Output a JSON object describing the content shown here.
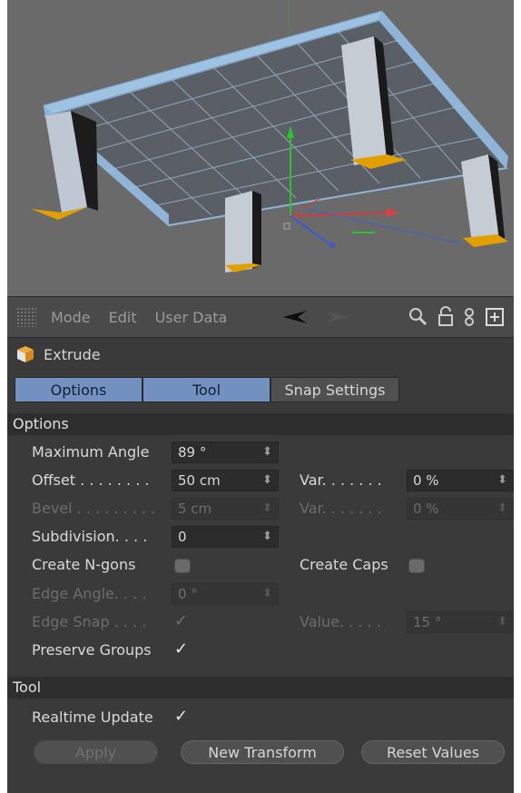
{
  "toolbar": {
    "menu": [
      "Mode",
      "Edit",
      "User Data"
    ],
    "icons": [
      "grip-icon",
      "back-arrow-icon",
      "forward-arrow-icon",
      "search-icon",
      "lock-icon",
      "link-icon",
      "new-panel-icon"
    ]
  },
  "object": {
    "name": "Extrude",
    "icon": "extrude-icon"
  },
  "tabs": [
    "Options",
    "Tool",
    "Snap Settings"
  ],
  "active_tabs": [
    "Options",
    "Tool"
  ],
  "sections": {
    "options": "Options",
    "tool": "Tool"
  },
  "fields": {
    "maximum_angle": {
      "label": "Maximum Angle",
      "value": "89 °"
    },
    "offset": {
      "label": "Offset . . . . . . . .",
      "value": "50 cm",
      "var_label": "Var. . . . . . .",
      "var_value": "0 %"
    },
    "bevel": {
      "label": "Bevel . . . . . . . . .",
      "value": "5 cm",
      "var_label": "Var. . . . . . .",
      "var_value": "0 %"
    },
    "subdivision": {
      "label": "Subdivision. . . .",
      "value": "0"
    },
    "create_ngons": {
      "label": "Create N-gons",
      "checked": false
    },
    "create_caps": {
      "label": "Create Caps",
      "checked": false
    },
    "edge_angle": {
      "label": "Edge Angle. . . .",
      "value": "0 °"
    },
    "edge_snap": {
      "label": "Edge Snap . . . .",
      "checked": true,
      "value_label": "Value. . . . .",
      "value": "15 °"
    },
    "preserve_groups": {
      "label": "Preserve Groups",
      "checked": true
    },
    "realtime_update": {
      "label": "Realtime Update",
      "checked": true
    }
  },
  "buttons": {
    "apply": "Apply",
    "new_transform": "New Transform",
    "reset_values": "Reset Values"
  },
  "glyphs": {
    "check": "✓",
    "spin": "⬍"
  },
  "colors": {
    "viewport_bg": "#6a6a6a",
    "panel_bg": "#3a3a3a",
    "tab_active": "#7391c0",
    "mesh_blue": "#8fb4d8",
    "polygon_yellow": "#e2a000"
  }
}
